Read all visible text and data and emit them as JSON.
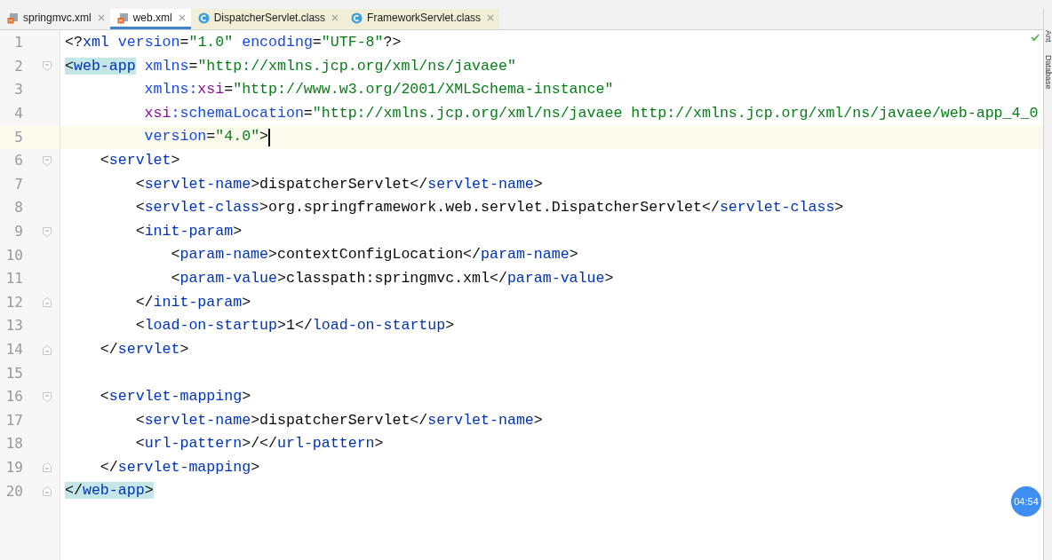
{
  "tabs": [
    {
      "label": "springmvc.xml",
      "kind": "xml",
      "selected": false
    },
    {
      "label": "web.xml",
      "kind": "xml",
      "selected": true
    },
    {
      "label": "DispatcherServlet.class",
      "kind": "class",
      "selected": false
    },
    {
      "label": "FrameworkServlet.class",
      "kind": "class",
      "selected": false
    }
  ],
  "side_tools": [
    "Ant",
    "Database"
  ],
  "timer": "04:54",
  "lines": [
    {
      "number": "1",
      "current": false,
      "tokens": [
        {
          "kind": "punct",
          "text": "<?"
        },
        {
          "kind": "tag",
          "text": "xml"
        },
        {
          "kind": "attr",
          "text": " version"
        },
        {
          "kind": "punct",
          "text": "="
        },
        {
          "kind": "string",
          "text": "\"1.0\" "
        },
        {
          "kind": "attr",
          "text": "encoding"
        },
        {
          "kind": "punct",
          "text": "="
        },
        {
          "kind": "string",
          "text": "\"UTF-8\""
        },
        {
          "kind": "punct",
          "text": "?>"
        }
      ]
    },
    {
      "number": "2",
      "kind": "fold_start",
      "current": false,
      "tokens": [
        {
          "kind": "punct",
          "text": "<",
          "matched": true
        },
        {
          "kind": "tag",
          "text": "web-app",
          "matched": true
        },
        {
          "kind": "attr",
          "text": " xmlns"
        },
        {
          "kind": "punct",
          "text": "="
        },
        {
          "kind": "string",
          "text": "\"http://xmlns.jcp.org/xml/ns/javaee\""
        }
      ],
      "attribute_lines": [
        {
          "number": "3",
          "current": false,
          "tokens": [
            {
              "kind": "attr",
              "text": "xmlns:"
            },
            {
              "kind": "ns",
              "text": "xsi"
            },
            {
              "kind": "punct",
              "text": "="
            },
            {
              "kind": "string",
              "text": "\"http://www.w3.org/2001/XMLSchema-instance\""
            }
          ]
        },
        {
          "number": "4",
          "current": false,
          "tokens": [
            {
              "kind": "ns",
              "text": "xsi"
            },
            {
              "kind": "attr",
              "text": ":schemaLocation"
            },
            {
              "kind": "punct",
              "text": "="
            },
            {
              "kind": "string",
              "text": "\"http://xmlns.jcp.org/xml/ns/javaee http://xmlns.jcp.org/xml/ns/javaee/web-app_4_0"
            }
          ]
        },
        {
          "number": "5",
          "current": true,
          "tokens": [
            {
              "kind": "attr",
              "text": "version"
            },
            {
              "kind": "punct",
              "text": "="
            },
            {
              "kind": "string",
              "text": "\"4.0\""
            },
            {
              "kind": "punct",
              "text": ">"
            }
          ]
        }
      ],
      "children": [
        {
          "number": "6",
          "kind": "fold_start",
          "current": false,
          "tokens": [
            {
              "kind": "punct",
              "text": "<"
            },
            {
              "kind": "tag",
              "text": "servlet"
            },
            {
              "kind": "punct",
              "text": ">"
            }
          ],
          "children": [
            {
              "number": "7",
              "current": false,
              "tokens": [
                {
                  "kind": "punct",
                  "text": "<"
                },
                {
                  "kind": "tag",
                  "text": "servlet-name"
                },
                {
                  "kind": "punct",
                  "text": ">dispatcherServlet</"
                },
                {
                  "kind": "tag",
                  "text": "servlet-name"
                },
                {
                  "kind": "punct",
                  "text": ">"
                }
              ]
            },
            {
              "number": "8",
              "current": false,
              "tokens": [
                {
                  "kind": "punct",
                  "text": "<"
                },
                {
                  "kind": "tag",
                  "text": "servlet-class"
                },
                {
                  "kind": "punct",
                  "text": ">org.springframework.web.servlet.DispatcherServlet</"
                },
                {
                  "kind": "tag",
                  "text": "servlet-class"
                },
                {
                  "kind": "punct",
                  "text": ">"
                }
              ]
            },
            {
              "number": "9",
              "kind": "fold_start",
              "current": false,
              "tokens": [
                {
                  "kind": "punct",
                  "text": "<"
                },
                {
                  "kind": "tag",
                  "text": "init-param"
                },
                {
                  "kind": "punct",
                  "text": ">"
                }
              ],
              "children": [
                {
                  "number": "10",
                  "current": false,
                  "tokens": [
                    {
                      "kind": "punct",
                      "text": "<"
                    },
                    {
                      "kind": "tag",
                      "text": "param-name"
                    },
                    {
                      "kind": "punct",
                      "text": ">contextConfigLocation</"
                    },
                    {
                      "kind": "tag",
                      "text": "param-name"
                    },
                    {
                      "kind": "punct",
                      "text": ">"
                    }
                  ]
                },
                {
                  "number": "11",
                  "current": false,
                  "tokens": [
                    {
                      "kind": "punct",
                      "text": "<"
                    },
                    {
                      "kind": "tag",
                      "text": "param-value"
                    },
                    {
                      "kind": "punct",
                      "text": ">classpath:springmvc.xml</"
                    },
                    {
                      "kind": "tag",
                      "text": "param-value"
                    },
                    {
                      "kind": "punct",
                      "text": ">"
                    }
                  ]
                }
              ]
            },
            {
              "number": "12",
              "kind": "fold_end",
              "current": false,
              "tokens": [
                {
                  "kind": "punct",
                  "text": "</"
                },
                {
                  "kind": "tag",
                  "text": "init-param"
                },
                {
                  "kind": "punct",
                  "text": ">"
                }
              ]
            },
            {
              "number": "13",
              "current": false,
              "tokens": [
                {
                  "kind": "punct",
                  "text": "<"
                },
                {
                  "kind": "tag",
                  "text": "load-on-startup"
                },
                {
                  "kind": "punct",
                  "text": ">1</"
                },
                {
                  "kind": "tag",
                  "text": "load-on-startup"
                },
                {
                  "kind": "punct",
                  "text": ">"
                }
              ]
            }
          ]
        },
        {
          "number": "14",
          "kind": "fold_end",
          "current": false,
          "tokens": [
            {
              "kind": "punct",
              "text": "</"
            },
            {
              "kind": "tag",
              "text": "servlet"
            },
            {
              "kind": "punct",
              "text": ">"
            }
          ]
        },
        {
          "number": "15",
          "current": false
        },
        {
          "number": "16",
          "kind": "fold_start",
          "current": false,
          "tokens": [
            {
              "kind": "punct",
              "text": "<"
            },
            {
              "kind": "tag",
              "text": "servlet-mapping"
            },
            {
              "kind": "punct",
              "text": ">"
            }
          ],
          "children": [
            {
              "number": "17",
              "current": false,
              "tokens": [
                {
                  "kind": "punct",
                  "text": "<"
                },
                {
                  "kind": "tag",
                  "text": "servlet-name"
                },
                {
                  "kind": "punct",
                  "text": ">dispatcherServlet</"
                },
                {
                  "kind": "tag",
                  "text": "servlet-name"
                },
                {
                  "kind": "punct",
                  "text": ">"
                }
              ]
            },
            {
              "number": "18",
              "current": false,
              "tokens": [
                {
                  "kind": "punct",
                  "text": "<"
                },
                {
                  "kind": "tag",
                  "text": "url-pattern"
                },
                {
                  "kind": "punct",
                  "text": ">/</"
                },
                {
                  "kind": "tag",
                  "text": "url-pattern"
                },
                {
                  "kind": "punct",
                  "text": ">"
                }
              ]
            }
          ]
        },
        {
          "number": "19",
          "kind": "fold_end",
          "current": false,
          "tokens": [
            {
              "kind": "punct",
              "text": "</"
            },
            {
              "kind": "tag",
              "text": "servlet-mapping"
            },
            {
              "kind": "punct",
              "text": ">"
            }
          ]
        }
      ]
    },
    {
      "number": "20",
      "kind": "fold_end",
      "current": false,
      "tokens": [
        {
          "kind": "punct",
          "text": "</",
          "matched": true
        },
        {
          "kind": "tag",
          "text": "web-app",
          "matched": true
        },
        {
          "kind": "punct",
          "text": ">",
          "matched": true
        }
      ]
    }
  ]
}
